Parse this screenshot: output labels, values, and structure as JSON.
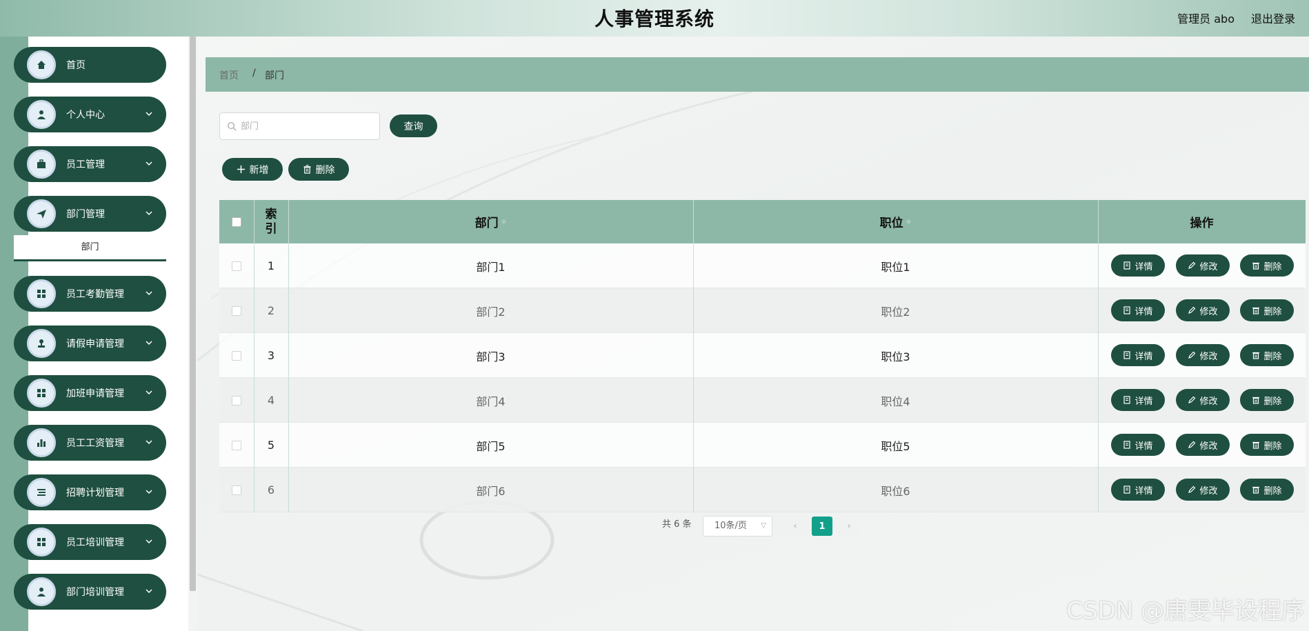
{
  "header": {
    "title": "人事管理系统",
    "user_label": "管理员 abo",
    "logout_label": "退出登录"
  },
  "sidebar": {
    "items": [
      {
        "label": "首页",
        "icon": "home-icon",
        "has_arrow": false
      },
      {
        "label": "个人中心",
        "icon": "user-icon",
        "has_arrow": true
      },
      {
        "label": "员工管理",
        "icon": "briefcase-icon",
        "has_arrow": true
      },
      {
        "label": "部门管理",
        "icon": "send-icon",
        "has_arrow": true
      },
      {
        "label": "员工考勤管理",
        "icon": "grid-icon",
        "has_arrow": true
      },
      {
        "label": "请假申请管理",
        "icon": "stamp-icon",
        "has_arrow": true
      },
      {
        "label": "加班申请管理",
        "icon": "grid-icon",
        "has_arrow": true
      },
      {
        "label": "员工工资管理",
        "icon": "bar-chart-icon",
        "has_arrow": true
      },
      {
        "label": "招聘计划管理",
        "icon": "list-icon",
        "has_arrow": true
      },
      {
        "label": "员工培训管理",
        "icon": "grid-icon",
        "has_arrow": true
      },
      {
        "label": "部门培训管理",
        "icon": "user-icon",
        "has_arrow": true
      }
    ],
    "submenu": {
      "label": "部门"
    }
  },
  "breadcrumb": {
    "home": "首页",
    "separator": "/",
    "current": "部门"
  },
  "search": {
    "placeholder": "部门",
    "value": "",
    "query_label": "查询"
  },
  "toolbar": {
    "add_label": "新增",
    "delete_label": "删除"
  },
  "table": {
    "headers": {
      "index": "索引",
      "dept": "部门",
      "position": "职位",
      "actions": "操作"
    },
    "rows": [
      {
        "index": "1",
        "dept": "部门1",
        "position": "职位1"
      },
      {
        "index": "2",
        "dept": "部门2",
        "position": "职位2"
      },
      {
        "index": "3",
        "dept": "部门3",
        "position": "职位3"
      },
      {
        "index": "4",
        "dept": "部门4",
        "position": "职位4"
      },
      {
        "index": "5",
        "dept": "部门5",
        "position": "职位5"
      },
      {
        "index": "6",
        "dept": "部门6",
        "position": "职位6"
      }
    ],
    "row_actions": {
      "detail": "详情",
      "edit": "修改",
      "delete": "删除"
    }
  },
  "pagination": {
    "total_text": "共 6 条",
    "page_size": "10条/页",
    "prev": "‹",
    "current_page": "1",
    "next": "›"
  },
  "watermark": "CSDN @唐雯毕设程序",
  "colors": {
    "accent": "#1f4f40",
    "header_row": "#8db8a7",
    "page_active": "#12a08a"
  }
}
